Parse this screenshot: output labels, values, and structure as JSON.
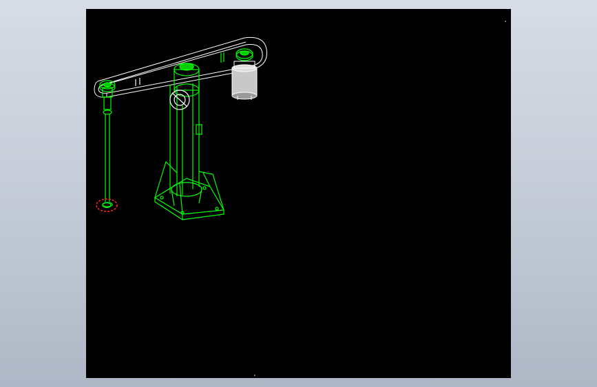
{
  "window": {
    "background_top": "#d7dde6",
    "background_bottom": "#aeb8c6"
  },
  "viewport": {
    "background": "#000000"
  },
  "colors": {
    "primary_edges": "#00ff00",
    "secondary_edges": "#ffffff",
    "highlight": "#ff2020",
    "motor_fill": "#c8c8c8"
  },
  "model": {
    "parts": [
      {
        "name": "arm-housing",
        "color": "secondary_edges"
      },
      {
        "name": "drive-pulley",
        "color": "primary_edges"
      },
      {
        "name": "motor",
        "color": "motor_fill"
      },
      {
        "name": "idler-pulley",
        "color": "primary_edges"
      },
      {
        "name": "vertical-shaft",
        "color": "primary_edges"
      },
      {
        "name": "shaft-end-marker",
        "color": "highlight"
      },
      {
        "name": "column",
        "color": "primary_edges"
      },
      {
        "name": "pivot-hub",
        "color": "primary_edges"
      },
      {
        "name": "column-base",
        "color": "primary_edges"
      }
    ]
  }
}
